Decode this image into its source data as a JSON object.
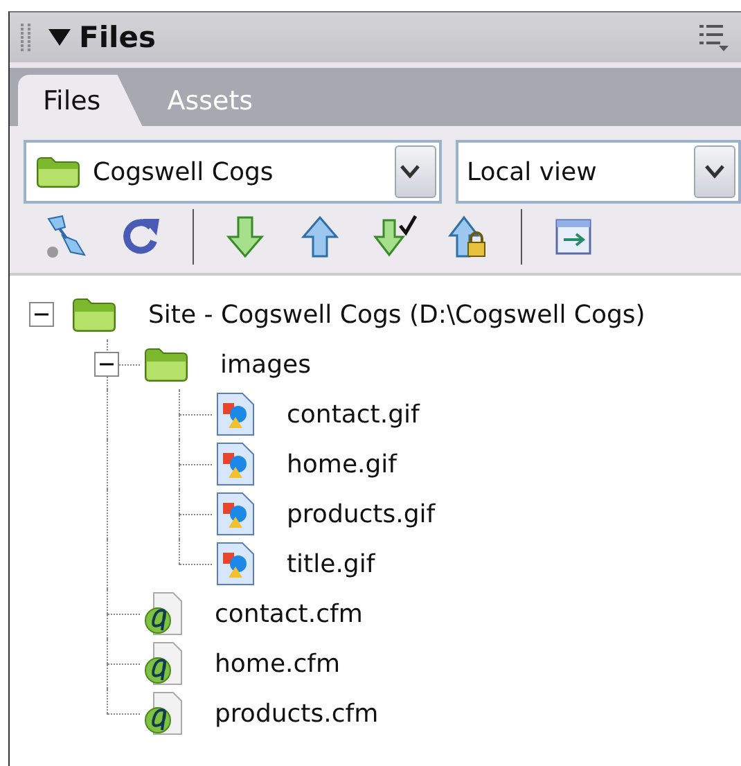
{
  "panel": {
    "title": "Files"
  },
  "tabs": [
    {
      "label": "Files",
      "selected": true
    },
    {
      "label": "Assets",
      "selected": false
    }
  ],
  "site_select": {
    "value": "Cogswell Cogs"
  },
  "view_select": {
    "value": "Local view"
  },
  "tree": [
    {
      "kind": "folder",
      "label": "Site - Cogswell Cogs (D:\\Cogswell Cogs)",
      "expanded": true,
      "children": [
        {
          "kind": "folder",
          "label": "images",
          "expanded": true,
          "children": [
            {
              "kind": "image",
              "label": "contact.gif"
            },
            {
              "kind": "image",
              "label": "home.gif"
            },
            {
              "kind": "image",
              "label": "products.gif"
            },
            {
              "kind": "image",
              "label": "title.gif"
            }
          ]
        },
        {
          "kind": "cfm",
          "label": "contact.cfm"
        },
        {
          "kind": "cfm",
          "label": "home.cfm"
        },
        {
          "kind": "cfm",
          "label": "products.cfm"
        }
      ]
    }
  ]
}
